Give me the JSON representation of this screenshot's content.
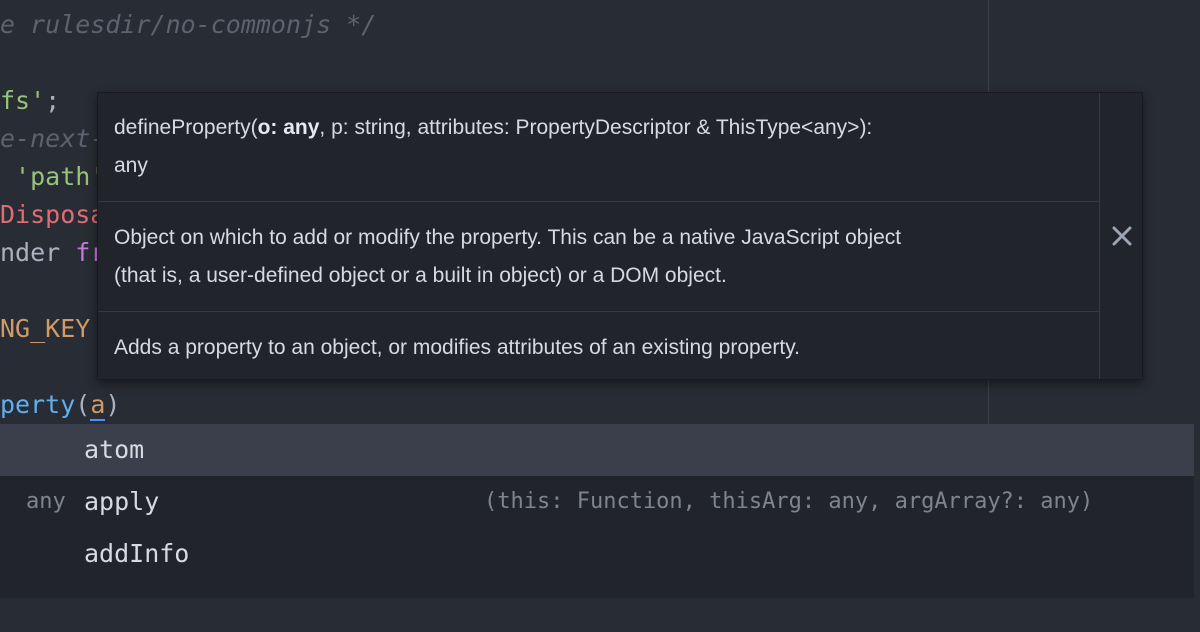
{
  "editor": {
    "lines": {
      "l1": {
        "comment": "e rulesdir/no-commonjs */"
      },
      "l2": {
        "str": "fs'",
        "semi": ";"
      },
      "l3": {
        "comment": "e-next-"
      },
      "l4": {
        "str": " 'path'"
      },
      "l5": {
        "cls": "Disposa"
      },
      "l6": {
        "ident": "nder ",
        "kw": "fr"
      },
      "l7": {
        "const": "NG_KEY"
      },
      "l8": {
        "fn": "perty",
        "open": "(",
        "arg": "a",
        "close": ")"
      }
    }
  },
  "signature_help": {
    "sig_name": "defineProperty(",
    "sig_param_active": "o: any",
    "sig_rest": ", p: string, attributes: PropertyDescriptor & ThisType<any>):",
    "sig_return": "any",
    "param_doc_line1": "Object on which to add or modify the property. This can be a native JavaScript object",
    "param_doc_line2": "(that is, a user-defined object or a built in object) or a DOM object.",
    "summary": "Adds a property to an object, or modifies attributes of an existing property.",
    "close_icon": "close-icon"
  },
  "autocomplete": {
    "items": [
      {
        "type": "",
        "text": "atom",
        "right": ""
      },
      {
        "type": "any",
        "text": "apply",
        "right": "(this: Function, thisArg: any, argArray?: any)"
      },
      {
        "type": "",
        "text": "addInfo",
        "right": ""
      }
    ],
    "selected_index": 0
  },
  "colors": {
    "background": "#282c34",
    "tooltip_bg": "#21252b",
    "selected_row": "#3a3f4b",
    "string": "#98c379",
    "constant": "#d19a66",
    "class": "#e06c75",
    "keyword": "#c678dd",
    "function": "#61afef",
    "comment": "#5c6370"
  }
}
